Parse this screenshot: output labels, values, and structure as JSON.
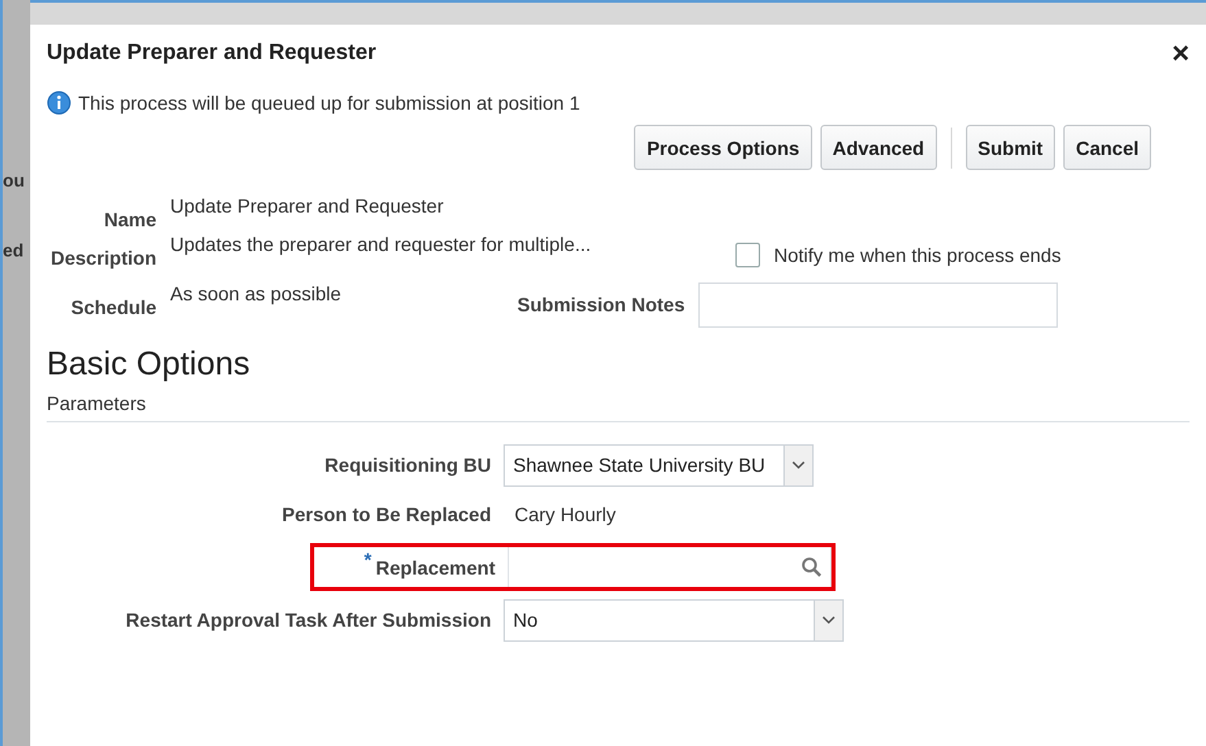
{
  "background_fragments": [
    "ou",
    "ed"
  ],
  "dialog": {
    "title": "Update Preparer and Requester",
    "close": "×",
    "info_message": "This process will be queued up for submission at position 1",
    "button_groups": [
      {
        "buttons": [
          "Process Options",
          "Advanced"
        ]
      },
      {
        "buttons": [
          "Submit",
          "Cancel"
        ]
      }
    ],
    "details": [
      {
        "label": "Name",
        "value": "Update Preparer and Requester"
      },
      {
        "label": "Description",
        "value": "Updates the preparer and requester for multiple..."
      },
      {
        "label": "Schedule",
        "value": "As soon as possible"
      }
    ],
    "notify": {
      "label": "Notify me when this process ends",
      "checked": false
    },
    "submission_notes": {
      "label": "Submission Notes"
    },
    "section_title": "Basic Options",
    "subsection_title": "Parameters",
    "parameters": [
      {
        "kind": "select",
        "label": "Requisitioning BU",
        "value": "Shawnee State University BU",
        "highlighted": false
      },
      {
        "kind": "text",
        "label": "Person to Be Replaced",
        "value": "Cary Hourly",
        "highlighted": false
      },
      {
        "kind": "search",
        "label": "Replacement",
        "required_mark": "*",
        "highlighted": true
      },
      {
        "kind": "select",
        "label": "Restart Approval Task After Submission",
        "value": "No",
        "highlighted": false,
        "wide": true
      }
    ]
  }
}
